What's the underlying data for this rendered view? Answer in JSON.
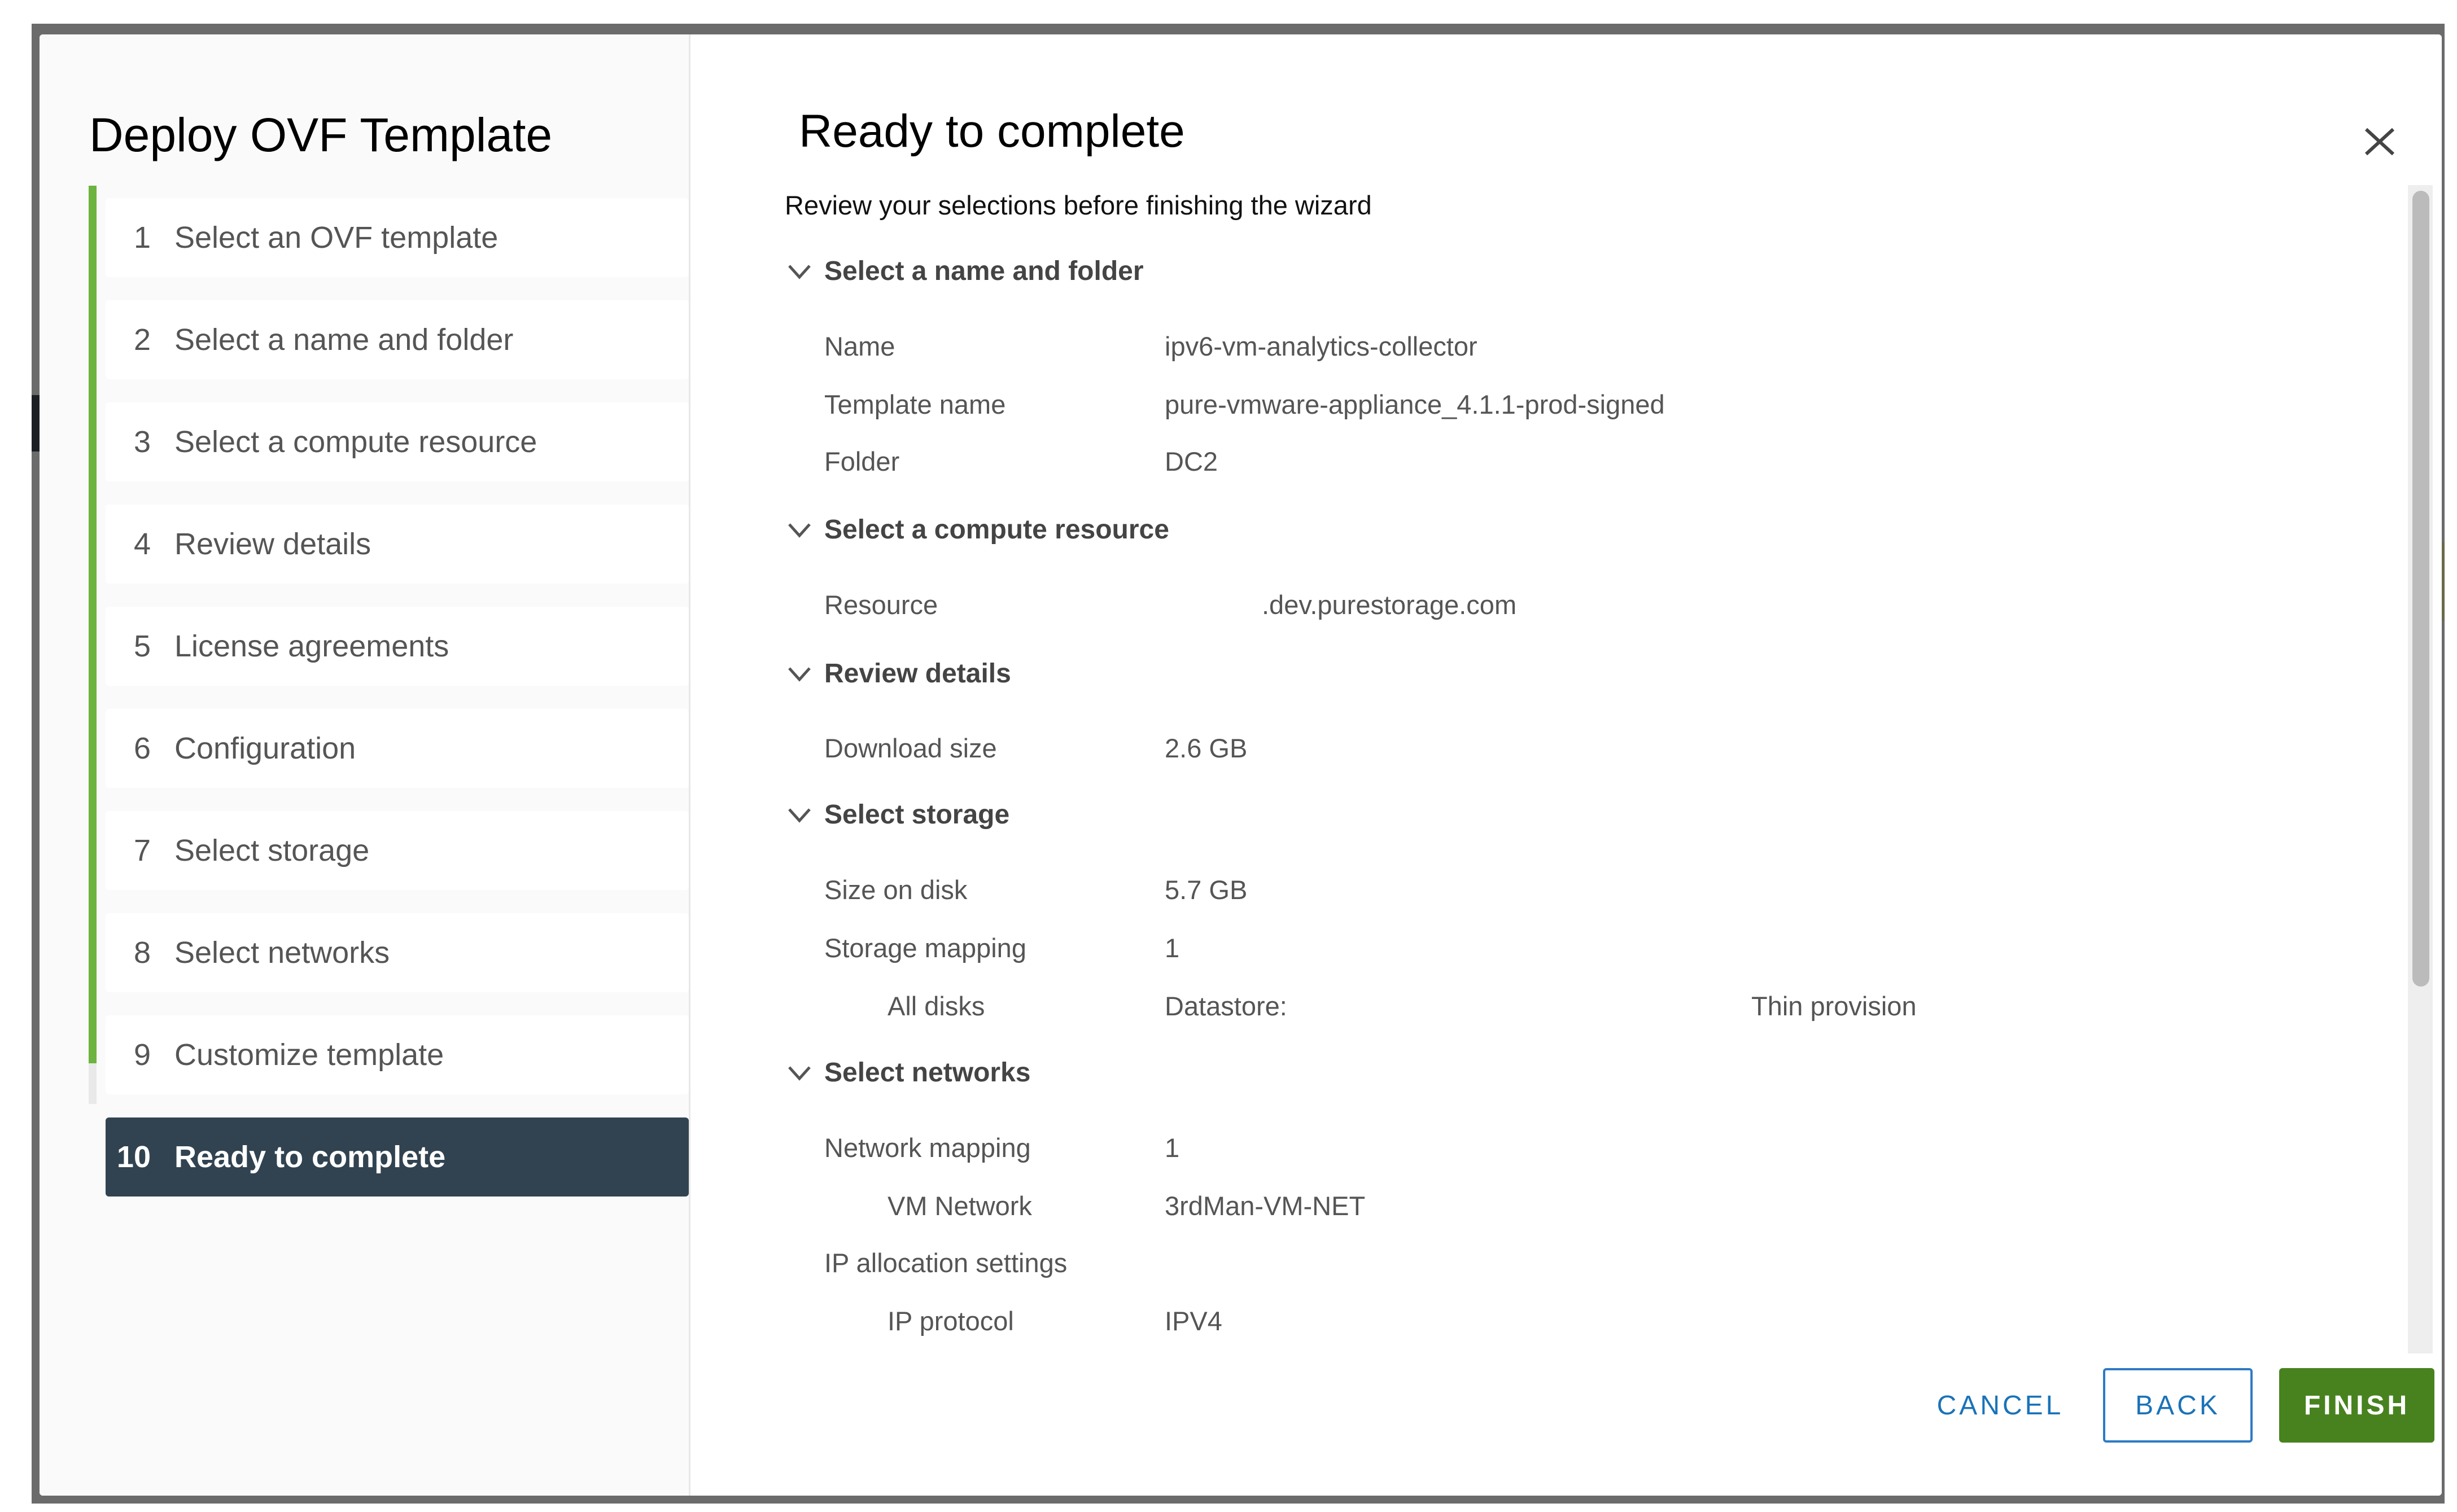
{
  "wizard": {
    "title": "Deploy OVF Template",
    "steps": [
      {
        "num": "1",
        "label": "Select an OVF template",
        "state": "done"
      },
      {
        "num": "2",
        "label": "Select a name and folder",
        "state": "done"
      },
      {
        "num": "3",
        "label": "Select a compute resource",
        "state": "done"
      },
      {
        "num": "4",
        "label": "Review details",
        "state": "done"
      },
      {
        "num": "5",
        "label": "License agreements",
        "state": "done"
      },
      {
        "num": "6",
        "label": "Configuration",
        "state": "done"
      },
      {
        "num": "7",
        "label": "Select storage",
        "state": "done"
      },
      {
        "num": "8",
        "label": "Select networks",
        "state": "done"
      },
      {
        "num": "9",
        "label": "Customize template",
        "state": "done"
      },
      {
        "num": "10",
        "label": "Ready to complete",
        "state": "active"
      }
    ]
  },
  "page": {
    "title": "Ready to complete",
    "subtitle": "Review your selections before finishing the wizard"
  },
  "sections": {
    "name_folder": {
      "title": "Select a name and folder",
      "rows": [
        {
          "label": "Name",
          "value": "ipv6-vm-analytics-collector"
        },
        {
          "label": "Template name",
          "value": "pure-vmware-appliance_4.1.1-prod-signed"
        },
        {
          "label": "Folder",
          "value": "DC2"
        }
      ]
    },
    "compute": {
      "title": "Select a compute resource",
      "rows": [
        {
          "label": "Resource",
          "value": ".dev.purestorage.com"
        }
      ]
    },
    "review": {
      "title": "Review details",
      "rows": [
        {
          "label": "Download size",
          "value": "2.6 GB"
        }
      ]
    },
    "storage": {
      "title": "Select storage",
      "rows": [
        {
          "label": "Size on disk",
          "value": "5.7 GB"
        },
        {
          "label": "Storage mapping",
          "value": "1"
        },
        {
          "label": "All disks",
          "value": "Datastore:",
          "extra": "Thin provision"
        }
      ]
    },
    "networks": {
      "title": "Select networks",
      "rows": [
        {
          "label": "Network mapping",
          "value": "1"
        },
        {
          "label": "VM Network",
          "value": "3rdMan-VM-NET"
        },
        {
          "label": "IP allocation settings",
          "value": ""
        },
        {
          "label": "IP protocol",
          "value": "IPV4"
        }
      ]
    }
  },
  "footer": {
    "cancel_label": "CANCEL",
    "back_label": "BACK",
    "finish_label": "FINISH"
  },
  "colors": {
    "progress_green": "#6db33f",
    "active_step_bg": "#314351",
    "link_blue": "#1a73b8",
    "finish_green": "#48821f"
  }
}
